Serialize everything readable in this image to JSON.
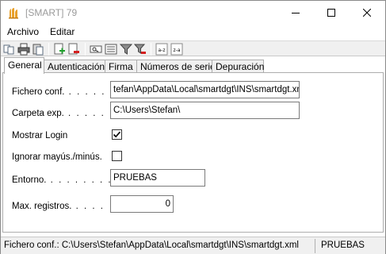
{
  "window": {
    "title": "[SMART] 79",
    "accent": "#e8a02a"
  },
  "menu": {
    "items": [
      "Archivo",
      "Editar"
    ]
  },
  "toolbar": {
    "icons": [
      "copy-icon",
      "print-icon",
      "paste-icon",
      "add-icon",
      "delete-icon",
      "preview-icon",
      "list-icon",
      "filter-icon",
      "filter-clear-icon",
      "sort-az-icon",
      "sort-za-icon"
    ],
    "sort_az_label": "a-z",
    "sort_za_label": "z-a"
  },
  "tabs": [
    {
      "label": "General",
      "active": true
    },
    {
      "label": "Autenticación",
      "active": false
    },
    {
      "label": "Firma",
      "active": false
    },
    {
      "label": "Números de serie",
      "active": false
    },
    {
      "label": "Depuración",
      "active": false
    }
  ],
  "form": {
    "fichero_conf": {
      "label": "Fichero conf.",
      "value": "tefan\\AppData\\Local\\smartdgt\\INS\\smartdgt.xml"
    },
    "carpeta_exp": {
      "label": "Carpeta exp.",
      "value": "C:\\Users\\Stefan\\"
    },
    "mostrar_login": {
      "label": "Mostrar Login",
      "checked": true
    },
    "ignorar_mayus": {
      "label": "Ignorar mayús./minús.",
      "checked": false
    },
    "entorno": {
      "label": "Entorno.",
      "value": "PRUEBAS"
    },
    "max_registros": {
      "label": "Max. registros.",
      "value": "0"
    }
  },
  "statusbar": {
    "left": "Fichero conf.: C:\\Users\\Stefan\\AppData\\Local\\smartdgt\\INS\\smartdgt.xml",
    "right": "PRUEBAS"
  }
}
